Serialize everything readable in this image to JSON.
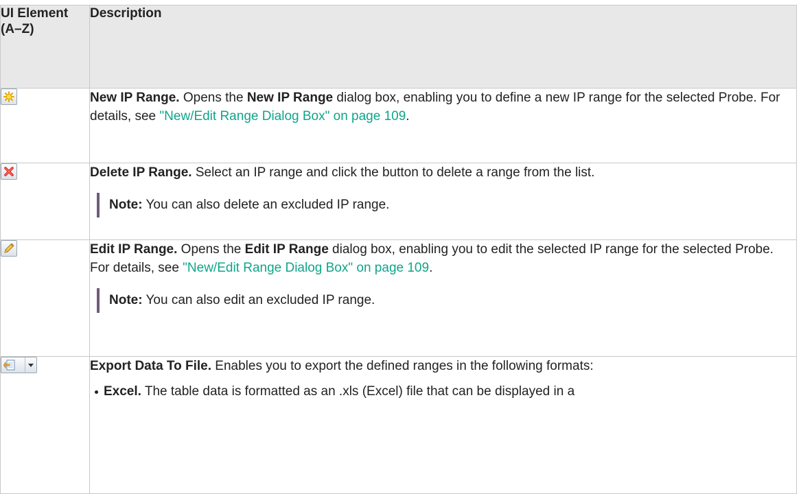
{
  "header": {
    "col1": "UI Element (A–Z)",
    "col2": "Description"
  },
  "rows": [
    {
      "icon": "new-range-star-icon",
      "title": "New IP Range.",
      "text1": " Opens the ",
      "bold1": "New IP Range",
      "text2": " dialog box, enabling you to define a new IP range for the selected Probe. For details, see ",
      "link": "\"New/Edit Range Dialog Box\" on page 109",
      "text3": "."
    },
    {
      "icon": "delete-x-icon",
      "title": "Delete IP Range.",
      "text1": " Select an IP range and click the button to delete a range from the list.",
      "note_label": "Note:",
      "note_text": " You can also delete an excluded IP range."
    },
    {
      "icon": "edit-pencil-icon",
      "title": "Edit IP Range.",
      "text1": " Opens the ",
      "bold1": "Edit IP Range",
      "text2": " dialog box, enabling you to edit the selected IP range for the selected Probe. For details, see ",
      "link": "\"New/Edit Range Dialog Box\" on page 109",
      "text3": ".",
      "note_label": "Note:",
      "note_text": " You can also edit an excluded IP range."
    },
    {
      "icon": "export-data-icon",
      "title": "Export Data To File.",
      "text1": " Enables you to export the defined ranges in the following formats:",
      "bullet_label": "Excel.",
      "bullet_text": " The table data is formatted as an .xls (Excel) file that can be displayed in a"
    }
  ]
}
